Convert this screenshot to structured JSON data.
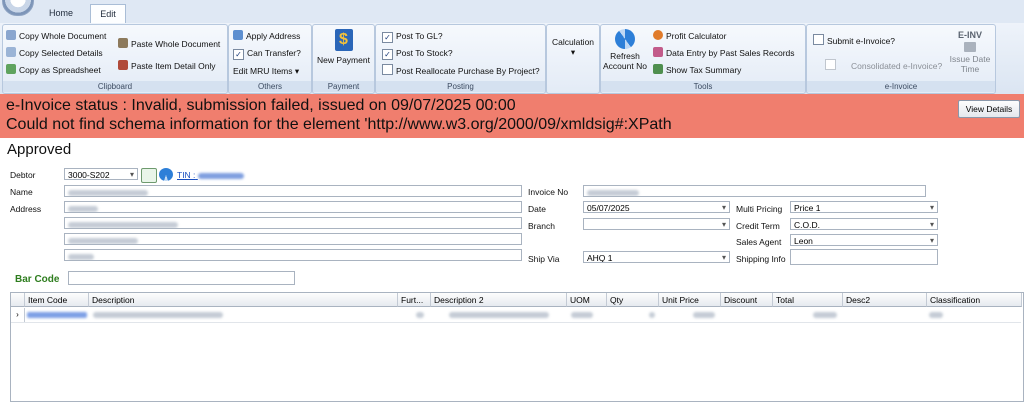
{
  "tabs": [
    {
      "label": "Home"
    },
    {
      "label": "Edit"
    }
  ],
  "ribbon": {
    "clipboard": {
      "title": "Clipboard",
      "copy_whole": "Copy Whole Document",
      "copy_selected": "Copy Selected Details",
      "copy_spreadsheet": "Copy as Spreadsheet",
      "paste_whole": "Paste Whole Document",
      "paste_item": "Paste Item Detail Only"
    },
    "others": {
      "title": "Others",
      "apply_address": "Apply Address",
      "can_transfer": "Can Transfer?",
      "edit_mru": "Edit MRU Items"
    },
    "payment": {
      "title": "Payment",
      "new_payment": "New Payment"
    },
    "posting": {
      "title": "Posting",
      "post_gl": "Post To GL?",
      "post_stock": "Post To Stock?",
      "post_reallocate": "Post Reallocate Purchase By Project?"
    },
    "calculation": {
      "label": "Calculation"
    },
    "tools": {
      "title": "Tools",
      "refresh": "Refresh Account No",
      "profit": "Profit Calculator",
      "data_entry": "Data Entry by Past Sales Records",
      "tax_summary": "Show Tax Summary"
    },
    "einvoice": {
      "title": "e-Invoice",
      "submit": "Submit e-Invoice?",
      "consolidated": "Consolidated e-Invoice?",
      "einv": "E-INV",
      "issue_date": "Issue Date Time"
    }
  },
  "banner": {
    "line1": "e-Invoice status : Invalid, submission failed, issued on 09/07/2025 00:00",
    "line2": "Could not find schema information for the element 'http://www.w3.org/2000/09/xmldsig#:XPath",
    "view_details": "View Details",
    "color": "#f07e6e"
  },
  "status_title": "Approved",
  "form": {
    "debtor_label": "Debtor",
    "debtor_value": "3000-S202",
    "tin_label": "TIN :",
    "name_label": "Name",
    "address_label": "Address",
    "invoice_no_label": "Invoice No",
    "date_label": "Date",
    "date_value": "05/07/2025",
    "branch_label": "Branch",
    "ship_via_label": "Ship Via",
    "ship_via_value": "AHQ 1",
    "multi_pricing_label": "Multi Pricing",
    "multi_pricing_value": "Price 1",
    "credit_term_label": "Credit Term",
    "credit_term_value": "C.O.D.",
    "sales_agent_label": "Sales Agent",
    "sales_agent_value": "Leon",
    "shipping_info_label": "Shipping Info",
    "bar_code_label": "Bar Code"
  },
  "grid": {
    "columns": [
      "Item Code",
      "Description",
      "Furt...",
      "Description 2",
      "UOM",
      "Qty",
      "Unit Price",
      "Discount",
      "Total",
      "Desc2",
      "Classification"
    ]
  }
}
